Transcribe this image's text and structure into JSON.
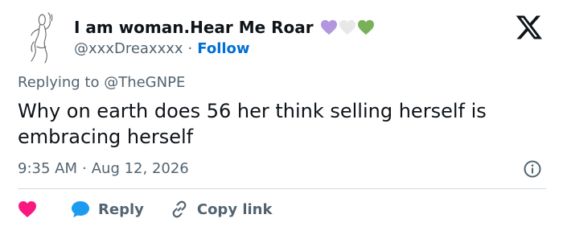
{
  "author": {
    "display_name": "I am woman.Hear Me Roar",
    "badges": [
      {
        "icon": "purple-heart-icon",
        "color": "#b197e0"
      },
      {
        "icon": "white-heart-icon",
        "color": "#e6e6e6"
      },
      {
        "icon": "green-heart-icon",
        "color": "#78b159"
      }
    ],
    "handle": "@xxxDreaxxxx",
    "separator": "·",
    "follow_label": "Follow"
  },
  "platform_icon": "x-logo-icon",
  "reply_context": "Replying to @TheGNPE",
  "tweet_text": "Why on earth does 56 her think selling herself is embracing herself",
  "meta": {
    "time": "9:35 AM",
    "separator": "·",
    "date": "Aug 12, 2026",
    "info_icon": "info-icon"
  },
  "actions": {
    "like_icon": "heart-icon",
    "reply_icon": "reply-bubble-icon",
    "reply_label": "Reply",
    "copy_icon": "link-icon",
    "copy_label": "Copy link"
  },
  "colors": {
    "text": "#0f1419",
    "muted": "#536471",
    "link": "#006fd6",
    "like": "#f91880",
    "reply": "#1d9bf0",
    "divider": "#cfd9de"
  }
}
